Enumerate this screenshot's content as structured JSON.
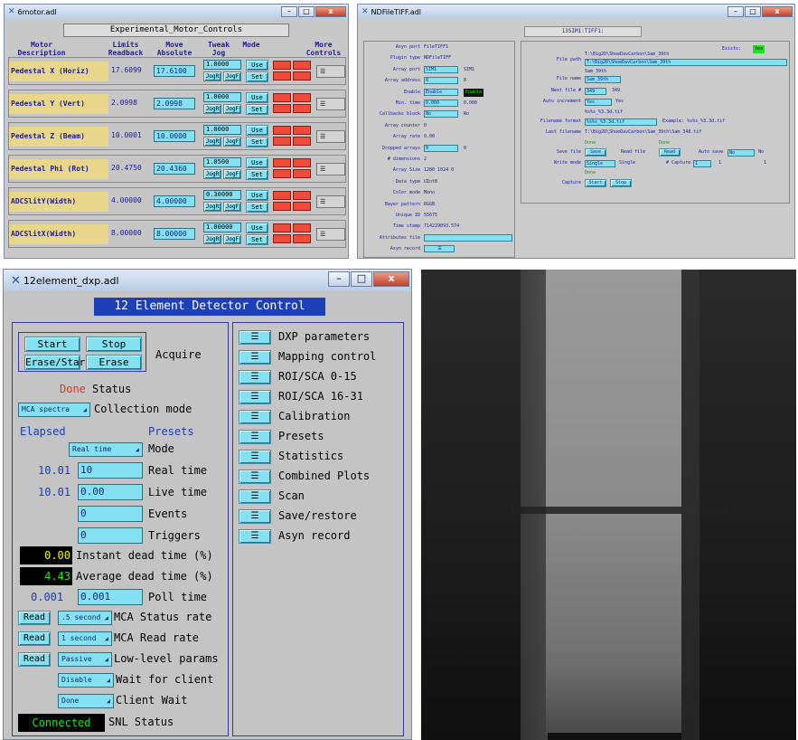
{
  "motor": {
    "window_title": "6motor.adl",
    "header": "Experimental_Motor_Controls",
    "columns": {
      "desc": "Motor\nDescription",
      "limits": "Limits\nReadback",
      "move": "Move\nAbsolute",
      "tweak": "Tweak\nJog",
      "mode": "Mode",
      "more": "More\nControls"
    },
    "use_label": "Use",
    "set_label": "Set",
    "jog_minus": "JogR",
    "jog_plus": "JogF",
    "more_label": "☰",
    "rows": [
      {
        "name": "Pedestal X (Horiz)",
        "readback": "17.6099",
        "absolute": "17.6100",
        "jog": "1.0000"
      },
      {
        "name": "Pedestal Y (Vert)",
        "readback": "2.0998",
        "absolute": "2.0998",
        "jog": "1.0000"
      },
      {
        "name": "Pedestal Z (Beam)",
        "readback": "10.0001",
        "absolute": "10.0000",
        "jog": "1.0000"
      },
      {
        "name": "Pedestal Phi (Rot)",
        "readback": "20.4750",
        "absolute": "20.4360",
        "jog": "1.0500"
      },
      {
        "name": "ADCSlitY(Width)",
        "readback": "4.00000",
        "absolute": "4.00000",
        "jog": "0.30000"
      },
      {
        "name": "ADCSlitX(Width)",
        "readback": "8.00000",
        "absolute": "8.00000",
        "jog": "1.00000"
      }
    ]
  },
  "tiff": {
    "window_title": "NDFileTIFF.adl",
    "banner": "13SIM1:TIFF1:",
    "left": [
      {
        "label": "Asyn port",
        "value": "FileTIFF1"
      },
      {
        "label": "Plugin type",
        "value": "NDFileTIFF"
      },
      {
        "label": "Array port",
        "value": "SIM1"
      },
      {
        "label": "Array address",
        "value": "0"
      },
      {
        "label": "Enable",
        "value": "Enable"
      },
      {
        "label": "Min. time",
        "value": "0.000"
      },
      {
        "label": "Callbacks block",
        "value": "No"
      },
      {
        "label": "Array counter",
        "value": "0"
      },
      {
        "label": "Array rate",
        "value": "0.00"
      },
      {
        "label": "Dropped arrays",
        "value": "0"
      },
      {
        "label": "# dimensions",
        "value": "2"
      },
      {
        "label": "Array Size",
        "value": "1280  1024  0"
      },
      {
        "label": "Data type",
        "value": "UInt8"
      },
      {
        "label": "Color mode",
        "value": "Mono"
      },
      {
        "label": "Bayer pattern",
        "value": "RGGB"
      },
      {
        "label": "Unique ID",
        "value": "55675"
      },
      {
        "label": "Time stamp",
        "value": "714229093.574"
      },
      {
        "label": "Attributes file",
        "value": ""
      },
      {
        "label": "Asyn record",
        "value": "☰"
      }
    ],
    "right": {
      "exists_label": "Exists:",
      "exists_value": "Yes",
      "file_path_label": "File path",
      "file_path_value": "T:\\Big2D\\ShoeDavCarbon\\Sam_39th",
      "file_name_label": "File name",
      "file_name_value": "Sam_39th",
      "next_file_label": "Next file #",
      "next_file_value": "349",
      "auto_inc_label": "Auto increment",
      "auto_inc_value": "Yes",
      "format_label": "Filename format",
      "format_value": "%s%s_%3.3d.tif",
      "example": "Example: %s%s_%3.3d.tif",
      "last_label": "Last filename",
      "last_value": "T:\\Big2D\\ShoeDavCarbon\\Sam_39th\\Sam_348.tif",
      "save_file_label": "Save file",
      "save_btn": "Save",
      "read_file_label": "Read file",
      "read_btn": "Read",
      "auto_save_label": "Auto save",
      "auto_save_value": "No",
      "write_mode_label": "Write mode",
      "write_mode_value": "Single",
      "capture_label": "# Capture",
      "capture_value": "1",
      "capture_btn_label": "Capture",
      "start_btn": "Start",
      "stop_btn": "Stop",
      "done_text": "Done"
    }
  },
  "dxp": {
    "window_title": "12element_dxp.adl",
    "title": "12 Element Detector Control",
    "acquire": {
      "start": "Start",
      "stop": "Stop",
      "erase_start": "Erase/Start",
      "erase": "Erase",
      "label": "Acquire"
    },
    "status": {
      "value": "Done",
      "label": "Status"
    },
    "collection": {
      "value": "MCA spectra",
      "label": "Collection mode"
    },
    "elapsed_label": "Elapsed",
    "presets_label": "Presets",
    "mode": {
      "value": "Real time",
      "label": "Mode"
    },
    "real_time": {
      "elapsed": "10.01",
      "preset": "10",
      "label": "Real time"
    },
    "live_time": {
      "elapsed": "10.01",
      "preset": "0.00",
      "label": "Live time"
    },
    "events": {
      "preset": "0",
      "label": "Events"
    },
    "triggers": {
      "preset": "0",
      "label": "Triggers"
    },
    "instant_dead": {
      "value": "0.00",
      "label": "Instant dead time (%)"
    },
    "average_dead": {
      "value": "4.43",
      "label": "Average dead time (%)"
    },
    "poll": {
      "value": "0.001",
      "setting": "0.001",
      "label": "Poll time"
    },
    "status_rate": {
      "btn": "Read",
      "value": ".5 second",
      "label": "MCA Status rate"
    },
    "read_rate": {
      "btn": "Read",
      "value": "1 second",
      "label": "MCA Read rate"
    },
    "low_level": {
      "btn": "Read",
      "value": "Passive",
      "label": "Low-level params"
    },
    "wait_client": {
      "value": "Disable",
      "label": "Wait for client"
    },
    "client_wait": {
      "value": "Done",
      "label": "Client Wait"
    },
    "snl": {
      "value": "Connected",
      "label": "SNL Status"
    },
    "related": [
      "DXP parameters",
      "Mapping control",
      "ROI/SCA 0-15",
      "ROI/SCA 16-31",
      "Calibration",
      "Presets",
      "Statistics",
      "Combined Plots",
      "Scan",
      "Save/restore",
      "Asyn record"
    ],
    "related_icon": "☰",
    "colors": {
      "accent_cyan": "#83e1f2",
      "title_blue": "#1d3fb8",
      "done_red": "#e8321e",
      "green": "#19e619",
      "yellow": "#f5f500"
    }
  }
}
